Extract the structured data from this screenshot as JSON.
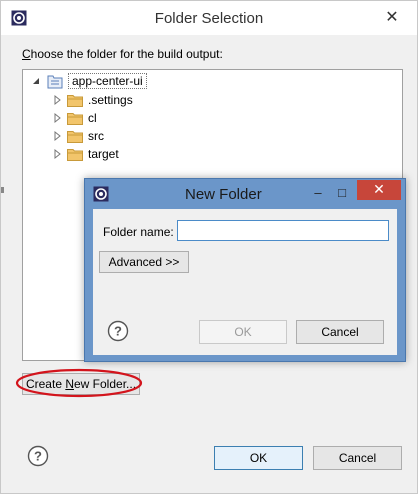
{
  "outer_dialog": {
    "title": "Folder Selection",
    "close_glyph": "✕",
    "prompt_underlined": "C",
    "prompt_rest": "hoose the folder for the build output:",
    "tree": {
      "root": {
        "label": "app-center-ui",
        "expanded": true
      },
      "children": [
        {
          "label": ".settings"
        },
        {
          "label": "cl"
        },
        {
          "label": "src"
        },
        {
          "label": "target"
        }
      ]
    },
    "create_folder_button": {
      "before": "Create ",
      "underlined": "N",
      "after": "ew Folder..."
    },
    "ok_label": "OK",
    "cancel_label": "Cancel",
    "highlight_color": "#d3141c"
  },
  "inner_dialog": {
    "title": "New Folder",
    "minimize_glyph": "–",
    "maximize_glyph": "□",
    "close_glyph": "✕",
    "folder_name_label": "Folder name:",
    "folder_name_value": "",
    "advanced_label": "Advanced >>",
    "ok_label": "OK",
    "cancel_label": "Cancel",
    "frame_color": "#6b96c9",
    "close_color": "#c7463a"
  }
}
